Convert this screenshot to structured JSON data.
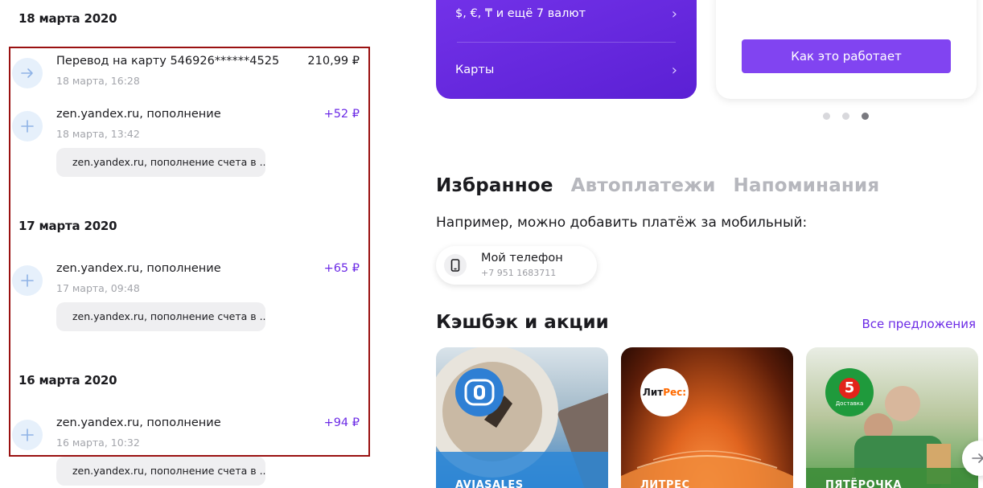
{
  "feed": {
    "dates": [
      "18 марта 2020",
      "17 марта 2020",
      "16 марта 2020"
    ],
    "transactions": [
      {
        "title": "Перевод на карту 546926******4525",
        "time": "18 марта, 16:28",
        "amount": "210,99 ₽",
        "icon": "arrow-right-icon"
      },
      {
        "title": "zen.yandex.ru, пополнение",
        "time": "18 марта, 13:42",
        "amount": "+52 ₽",
        "note": "zen.yandex.ru, пополнение счета в ...",
        "icon": "plus-icon"
      },
      {
        "title": "zen.yandex.ru, пополнение",
        "time": "17 марта, 09:48",
        "amount": "+65 ₽",
        "note": "zen.yandex.ru, пополнение счета в ...",
        "icon": "plus-icon"
      },
      {
        "title": "zen.yandex.ru, пополнение",
        "time": "16 марта, 10:32",
        "amount": "+94 ₽",
        "note": "zen.yandex.ru, пополнение счета в ...",
        "icon": "plus-icon"
      }
    ]
  },
  "wallet_card": {
    "currencies_label": "$, €, ₸ и ещё 7 валют",
    "cards_label": "Карты"
  },
  "promo_card": {
    "button_label": "Как это работает",
    "dots_count": 3,
    "active_dot": 3
  },
  "favorites": {
    "tabs": [
      "Избранное",
      "Автоплатежи",
      "Напоминания"
    ],
    "active_tab": "Избранное",
    "hint": "Например, можно добавить платёж за мобильный:",
    "chip": {
      "title": "Мой телефон",
      "subtitle": "+7 951 1683711",
      "icon": "phone-icon"
    }
  },
  "cashback": {
    "title": "Кэшбэк и акции",
    "all_link": "Все предложения",
    "offers": [
      {
        "name": "AVIASALES",
        "logo_icon": "aviasales-logo"
      },
      {
        "name": "ЛИТРЕС",
        "logo_text_1": "Лит",
        "logo_text_2": "Рес:"
      },
      {
        "name": "ПЯТЁРОЧКА",
        "logo_text": "5",
        "logo_sub": "Доставка"
      }
    ]
  },
  "colors": {
    "accent": "#6c2be6",
    "positive_amount": "#6c2be6",
    "highlight_border": "#9a1111",
    "button": "#8144f1"
  }
}
